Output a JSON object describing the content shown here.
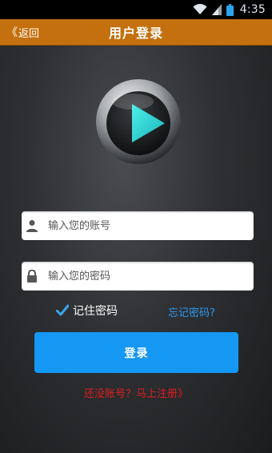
{
  "status_bar": {
    "time": "4:35"
  },
  "header": {
    "back_label": "返回",
    "title": "用户登录"
  },
  "form": {
    "username_placeholder": "输入您的账号",
    "password_placeholder": "输入您的密码",
    "remember_label": "记住密码",
    "remember_checked": true,
    "forgot_label": "忘记密码?",
    "login_label": "登录",
    "register_label": "还没账号？马上注册》"
  },
  "colors": {
    "title_bar": "#c4700e",
    "accent_blue": "#1597f4",
    "link_blue": "#2c9bf0",
    "register_red": "#e21d1d",
    "logo_play": "#2ed3d0"
  },
  "icons": [
    "wifi-icon",
    "signal-icon",
    "battery-icon",
    "back-chevron-icon",
    "play-logo-icon",
    "user-icon",
    "lock-icon",
    "checkmark-icon"
  ]
}
